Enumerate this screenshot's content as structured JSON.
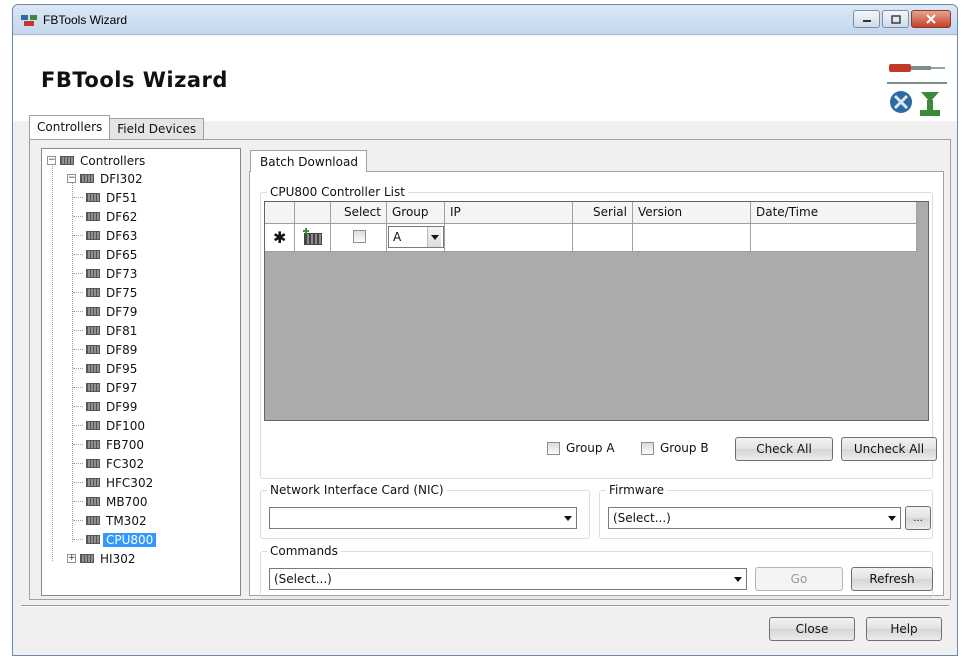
{
  "window": {
    "title": "FBTools Wizard",
    "header_title": "FBTools Wizard"
  },
  "outer_tabs": [
    {
      "label": "Controllers",
      "active": true
    },
    {
      "label": "Field Devices",
      "active": false
    }
  ],
  "tree": {
    "root": "Controllers",
    "groups": [
      {
        "label": "DFI302",
        "expanded": true,
        "children": [
          "DF51",
          "DF62",
          "DF63",
          "DF65",
          "DF73",
          "DF75",
          "DF79",
          "DF81",
          "DF89",
          "DF95",
          "DF97",
          "DF99",
          "DF100",
          "FB700",
          "FC302",
          "HFC302",
          "MB700",
          "TM302",
          "CPU800"
        ]
      },
      {
        "label": "HI302",
        "expanded": false,
        "children": []
      }
    ],
    "selected": "CPU800"
  },
  "inner_tab": {
    "label": "Batch Download"
  },
  "controller_list": {
    "legend": "CPU800 Controller List",
    "columns": [
      "Select",
      "Group",
      "IP",
      "Serial",
      "Version",
      "Date/Time"
    ],
    "new_row": {
      "marker": "✱",
      "group": "A"
    },
    "group_a_label": "Group A",
    "group_b_label": "Group B",
    "check_all": "Check All",
    "uncheck_all": "Uncheck All"
  },
  "nic": {
    "legend": "Network Interface Card (NIC)",
    "value": ""
  },
  "firmware": {
    "legend": "Firmware",
    "value": "(Select...)",
    "browse_label": "..."
  },
  "commands": {
    "legend": "Commands",
    "value": "(Select...)",
    "go_label": "Go",
    "refresh_label": "Refresh"
  },
  "footer": {
    "close_label": "Close",
    "help_label": "Help"
  },
  "colors": {
    "selection": "#3399ff",
    "grid_background": "#ababab"
  }
}
